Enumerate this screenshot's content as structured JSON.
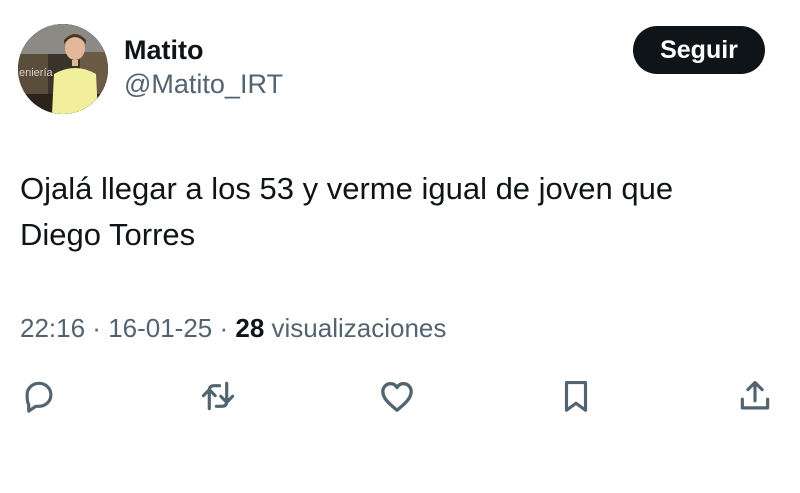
{
  "author": {
    "display_name": "Matito",
    "handle": "@Matito_IRT",
    "avatar_sign_text": "eniería"
  },
  "follow_button": {
    "label": "Seguir"
  },
  "tweet": {
    "line1": "Ojalá llegar a los 53 y verme igual de joven que",
    "line2": "Diego Torres"
  },
  "meta": {
    "time": "22:16",
    "separator": " · ",
    "date": "16-01-25",
    "views_count": "28",
    "views_label": " visualizaciones"
  },
  "actions": [
    "reply-icon",
    "retweet-icon",
    "like-icon",
    "bookmark-icon",
    "share-icon"
  ],
  "colors": {
    "text": "#0f1419",
    "secondary": "#536471",
    "button_bg": "#0f1419",
    "button_text": "#ffffff"
  }
}
